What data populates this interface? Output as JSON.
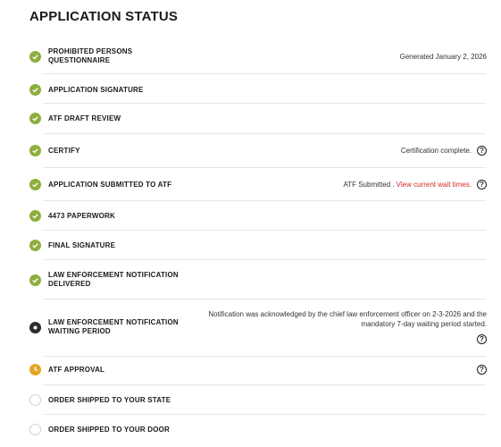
{
  "title": "APPLICATION STATUS",
  "colors": {
    "done": "#8dae3c",
    "current": "#2b2b2b",
    "pending": "#e3a622",
    "link": "#d02a2a"
  },
  "steps": [
    {
      "label": "PROHIBITED PERSONS QUESTIONNAIRE",
      "status": "done",
      "right": "Generated January 2, 2026"
    },
    {
      "label": "APPLICATION SIGNATURE",
      "status": "done"
    },
    {
      "label": "ATF DRAFT REVIEW",
      "status": "done"
    },
    {
      "label": "CERTIFY",
      "status": "done",
      "right": "Certification complete."
    },
    {
      "label": "APPLICATION SUBMITTED TO ATF",
      "status": "done",
      "right": "ATF Submitted .",
      "link": "View current wait times."
    },
    {
      "label": "4473 PAPERWORK",
      "status": "done"
    },
    {
      "label": "FINAL SIGNATURE",
      "status": "done"
    },
    {
      "label": "LAW ENFORCEMENT NOTIFICATION DELIVERED",
      "status": "done"
    },
    {
      "label": "LAW ENFORCEMENT NOTIFICATION WAITING PERIOD",
      "status": "current",
      "note": "Notification was acknowledged by the chief law enforcement officer on 2-3-2026 and the mandatory 7-day waiting period started."
    },
    {
      "label": "ATF APPROVAL",
      "status": "pending"
    },
    {
      "label": "ORDER SHIPPED TO YOUR STATE",
      "status": "todo"
    },
    {
      "label": "ORDER SHIPPED TO YOUR DOOR",
      "status": "todo"
    }
  ],
  "help_glyph": "?"
}
